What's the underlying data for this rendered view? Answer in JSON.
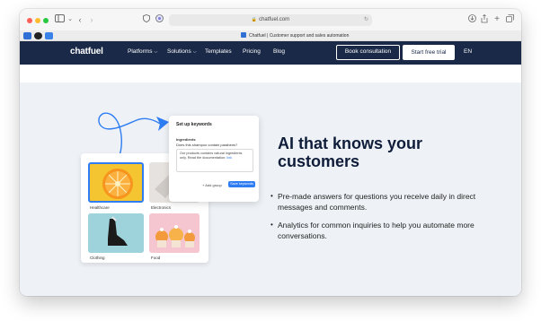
{
  "browser": {
    "url": "chatfuel.com",
    "tab_title": "Chatfuel | Customer support and sales automation"
  },
  "nav": {
    "logo": "chatfuel",
    "items": [
      {
        "label": "Platforms",
        "has_dropdown": true
      },
      {
        "label": "Solutions",
        "has_dropdown": true
      },
      {
        "label": "Templates",
        "has_dropdown": false
      },
      {
        "label": "Pricing",
        "has_dropdown": false
      },
      {
        "label": "Blog",
        "has_dropdown": false
      }
    ],
    "consult_label": "Book consultation",
    "trial_label": "Start free trial",
    "lang_label": "EN"
  },
  "illustration": {
    "keywords_card": {
      "title": "Set up keywords",
      "field_label": "Ingredients",
      "question": "Does this shampoo contain parabens?",
      "answer_text": "Our products contains natural ingredients only. Read the documentation:",
      "answer_link": "link",
      "add_group_label": "Add group",
      "save_label": "Save keywords"
    },
    "tiles": [
      {
        "label": "Healthcare"
      },
      {
        "label": "Electronics"
      },
      {
        "label": "Clothing"
      },
      {
        "label": "Food"
      }
    ]
  },
  "hero": {
    "headline": "AI that knows your customers",
    "bullets": [
      "Pre-made answers for questions  you receive daily in direct messages and comments.",
      "Analytics for common inquiries to help you automate more conversations."
    ]
  },
  "colors": {
    "nav_bg": "#192947",
    "hero_bg": "#eef2f6",
    "accent": "#2e7df3",
    "headline": "#0f1d3a"
  }
}
